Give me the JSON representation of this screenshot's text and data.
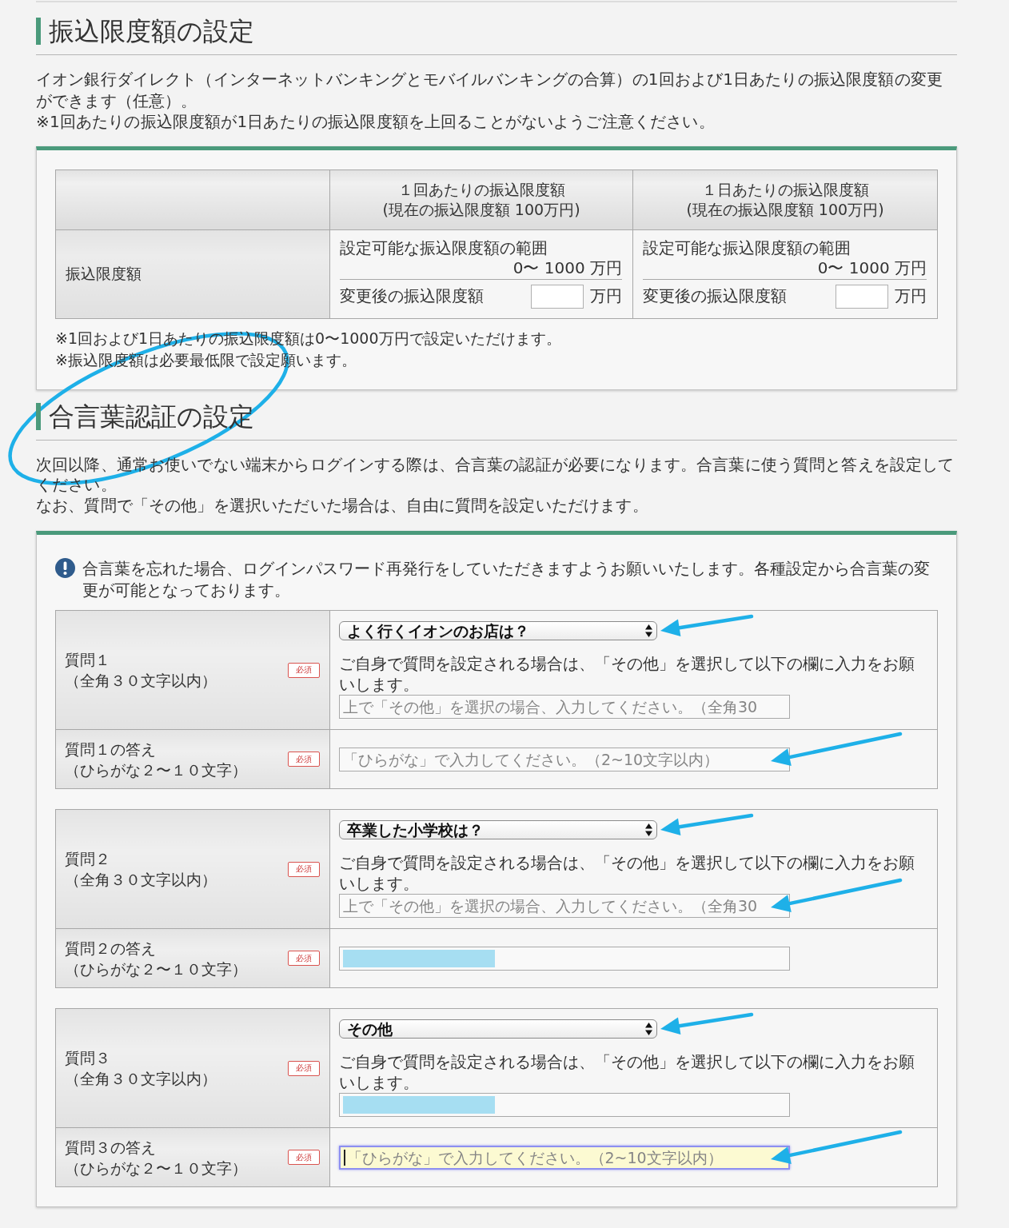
{
  "top_section": {
    "heading": {
      "text": "振込限度額の設定",
      "circled": false
    },
    "paragraphs": [
      "イオン銀行ダイレクト（インターネットバンキングとモバイルバンキングの合算）の1回および1日あたりの振込限度額の変更ができます（任意）。",
      "※1回あたりの振込限度額が1日あたりの振込限度額を上回ることがないようご注意ください。"
    ]
  },
  "limit_panel": {
    "row_label": "振込限度額",
    "columns": [
      {
        "title": "１回あたりの振込限度額",
        "current": "(現在の振込限度額 100万円)",
        "range_label": "設定可能な振込限度額の範囲",
        "range": "0〜 1000 万円",
        "new_label": "変更後の振込限度額",
        "unit": "万円"
      },
      {
        "title": "１日あたりの振込限度額",
        "current": "(現在の振込限度額 100万円)",
        "range_label": "設定可能な振込限度額の範囲",
        "range": "0〜 1000 万円",
        "new_label": "変更後の振込限度額",
        "unit": "万円"
      }
    ],
    "notes": [
      "※1回および1日あたりの振込限度額は0〜1000万円で設定いただけます。",
      "※振込限度額は必要最低限で設定願います。"
    ]
  },
  "passphrase_section": {
    "heading": {
      "text": "合言葉認証の設定",
      "circled": true
    },
    "paragraphs": [
      "次回以降、通常お使いでない端末からログインする際は、合言葉の認証が必要になります。合言葉に使う質問と答えを設定してください。",
      "なお、質問で「その他」を選択いただいた場合は、自由に質問を設定いただけます。"
    ]
  },
  "passphrase_panel": {
    "notice": "合言葉を忘れた場合、ログインパスワード再発行をしていただきますようお願いいたします。各種設定から合言葉の変更が可能となっております。",
    "questions": [
      {
        "label": "質問１",
        "hint": "（全角３０文字以内）",
        "badge": "必須",
        "select": {
          "value": "よく行くイオンのお店は？",
          "arrow_annotation": true
        },
        "explanation": "ご自身で質問を設定される場合は、「その他」を選択して以下の欄に入力をお願いします。",
        "custom_field": {
          "placeholder": "上で「その他」を選択の場合、入力してください。（全角30",
          "masked": false,
          "focused": false,
          "arrow_annotation": false
        },
        "answer": {
          "label": "質問１の答え",
          "hint": "（ひらがな２〜１０文字）",
          "badge": "必須",
          "field": {
            "placeholder": "「ひらがな」で入力してください。（2~10文字以内）",
            "masked": false,
            "focused": false,
            "arrow_annotation": true
          }
        }
      },
      {
        "label": "質問２",
        "hint": "（全角３０文字以内）",
        "badge": "必須",
        "select": {
          "value": "卒業した小学校は？",
          "arrow_annotation": true
        },
        "explanation": "ご自身で質問を設定される場合は、「その他」を選択して以下の欄に入力をお願いします。",
        "custom_field": {
          "placeholder": "上で「その他」を選択の場合、入力してください。（全角30",
          "masked": false,
          "focused": false,
          "arrow_annotation": true
        },
        "answer": {
          "label": "質問２の答え",
          "hint": "（ひらがな２〜１０文字）",
          "badge": "必須",
          "field": {
            "masked": true,
            "focused": false,
            "arrow_annotation": false
          }
        }
      },
      {
        "label": "質問３",
        "hint": "（全角３０文字以内）",
        "badge": "必須",
        "select": {
          "value": "その他",
          "arrow_annotation": true
        },
        "explanation": "ご自身で質問を設定される場合は、「その他」を選択して以下の欄に入力をお願いします。",
        "custom_field": {
          "masked": true,
          "focused": false,
          "arrow_annotation": false
        },
        "answer": {
          "label": "質問３の答え",
          "hint": "（ひらがな２〜１０文字）",
          "badge": "必須",
          "field": {
            "placeholder": "「ひらがな」で入力してください。（2~10文字以内）",
            "masked": false,
            "focused": true,
            "arrow_annotation": true
          }
        }
      }
    ]
  }
}
